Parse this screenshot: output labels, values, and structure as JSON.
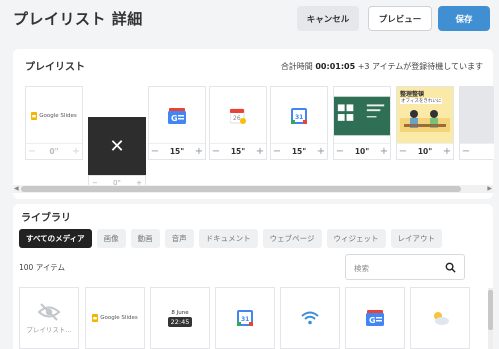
{
  "header": {
    "title": "プレイリスト 詳細",
    "cancel_label": "キャンセル",
    "preview_label": "プレビュー",
    "save_label": "保存"
  },
  "playlist": {
    "title": "プレイリスト",
    "total_prefix": "合計時間",
    "total_time": "00:01:05",
    "pending_note": "+3 アイテムが登録待機しています",
    "items": [
      {
        "name": "Google Slides",
        "duration": "0\"",
        "faded": true
      },
      {
        "name": "google-news",
        "duration": "15\""
      },
      {
        "name": "google-calendar",
        "duration": "15\""
      },
      {
        "name": "google-calendar-31",
        "duration": "15\""
      },
      {
        "name": "green-slide",
        "duration": "10\""
      },
      {
        "name": "office-cleanup-slide",
        "duration": "10\"",
        "caption_line1": "整理整頓",
        "caption_line2": "オフィスをきれいに"
      },
      {
        "name": "blank-item",
        "duration": ""
      }
    ],
    "drag_ghost_duration": "0\""
  },
  "library": {
    "title": "ライブラリ",
    "filters": [
      "すべてのメディア",
      "画像",
      "動画",
      "音声",
      "ドキュメント",
      "ウェブページ",
      "ウィジェット",
      "レイアウト"
    ],
    "count": "100 アイテム",
    "search_placeholder": "検索",
    "items": [
      {
        "name": "hidden-playlist",
        "label": "プレイリスト..."
      },
      {
        "name": "google-slides",
        "label": "Google Slides"
      },
      {
        "name": "clock",
        "day": "8 June",
        "time": "22:45"
      },
      {
        "name": "google-calendar-31"
      },
      {
        "name": "wifi"
      },
      {
        "name": "google-news"
      },
      {
        "name": "weather"
      }
    ]
  },
  "colors": {
    "accent": "#3f8fd2",
    "active_chip": "#222222"
  }
}
